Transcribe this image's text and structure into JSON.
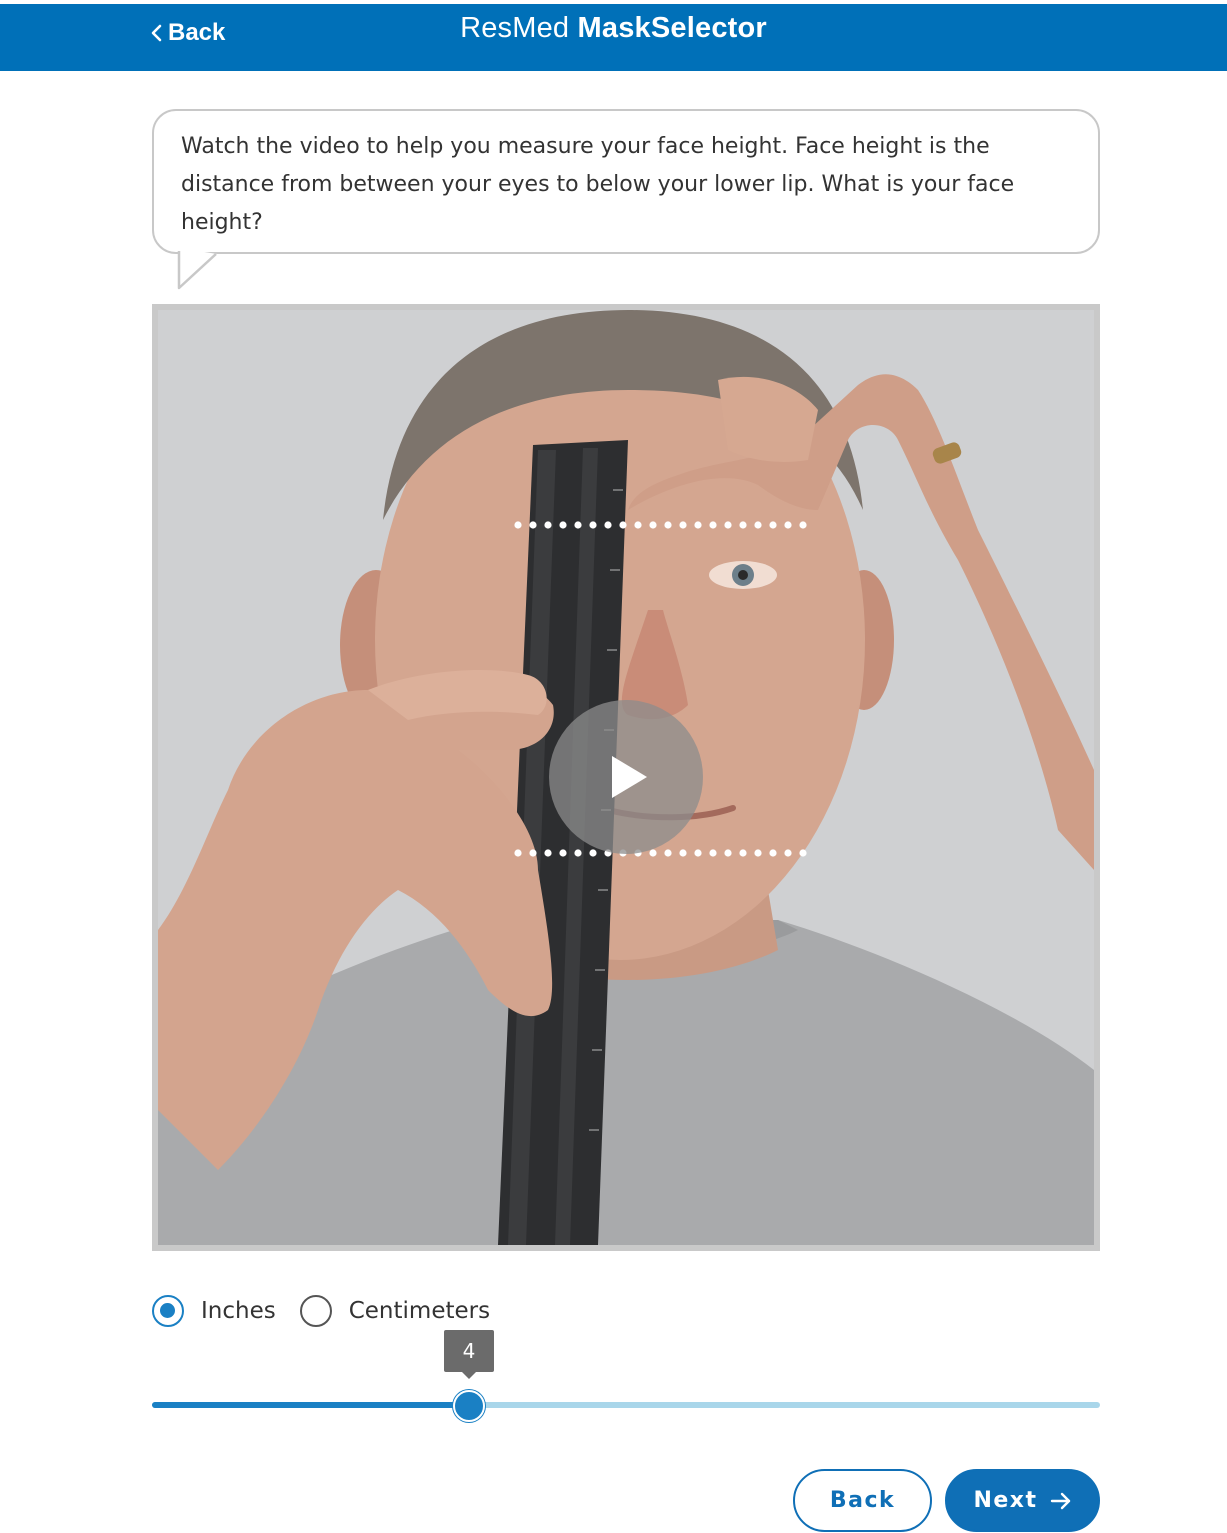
{
  "header": {
    "back_label": "Back",
    "brand_light": "ResMed",
    "brand_bold": "MaskSelector",
    "background": "#0070b8"
  },
  "prompt": {
    "text": "Watch the video to help you measure your face height. Face height is the distance from between your eyes to below your lower lip. What is your face height?"
  },
  "video": {
    "play_icon": "play-icon",
    "subject": "man measuring face height with ruler"
  },
  "units": {
    "options": [
      {
        "label": "Inches",
        "selected": true
      },
      {
        "label": "Centimeters",
        "selected": false
      }
    ]
  },
  "slider": {
    "value_label": "4",
    "value": 4,
    "fill_fraction": 0.334,
    "accent": "#1a80c4",
    "track_color": "#a9d6ea"
  },
  "footer": {
    "back_label": "Back",
    "next_label": "Next",
    "next_icon": "arrow-right-icon",
    "accent": "#0f6fb6"
  }
}
